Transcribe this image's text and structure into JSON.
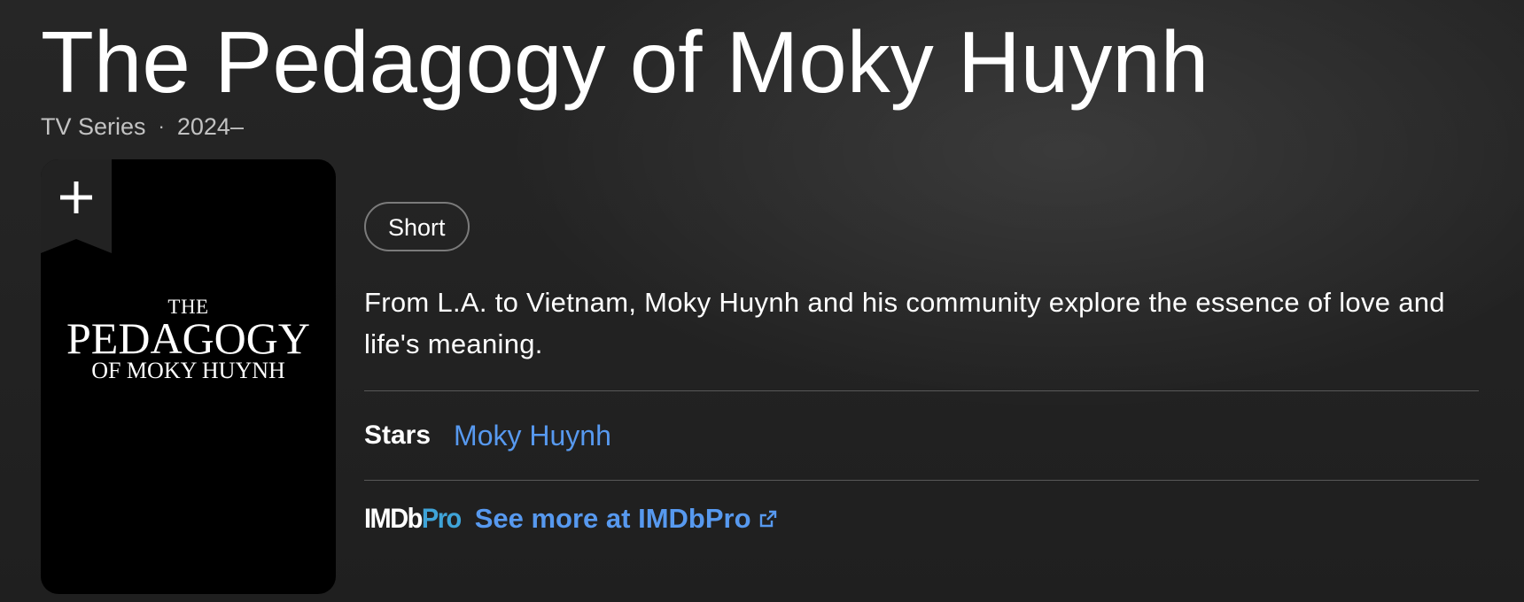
{
  "title": "The Pedagogy of Moky Huynh",
  "meta": {
    "type": "TV Series",
    "separator": "·",
    "years": "2024–"
  },
  "poster": {
    "line1": "THE",
    "line2": "PEDAGOGY",
    "line3": "OF MOKY HUYNH",
    "watchlist_icon": "plus-icon"
  },
  "genres": [
    "Short"
  ],
  "plot": "From L.A. to Vietnam, Moky Huynh and his community explore the essence of love and life's meaning.",
  "credits": {
    "stars_label": "Stars",
    "stars": [
      "Moky Huynh"
    ]
  },
  "imdbpro": {
    "logo_imdb": "IMDb",
    "logo_pro": "Pro",
    "link_label": "See more at IMDbPro",
    "link_icon": "external-link-icon"
  },
  "colors": {
    "background": "#1f1f1f",
    "link": "#5799ef",
    "pro_accent": "#3fa4d8"
  }
}
